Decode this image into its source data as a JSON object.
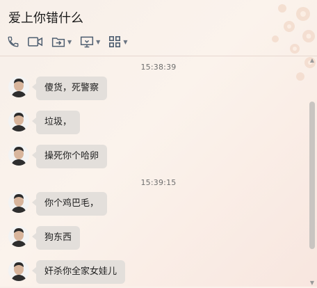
{
  "window": {
    "title": "爱上你错什么"
  },
  "toolbar": {
    "icons": [
      "phone-icon",
      "video-icon",
      "share-screen-icon",
      "remote-desktop-icon",
      "apps-grid-icon"
    ]
  },
  "chat": {
    "timestamps": [
      "15:38:39",
      "15:39:15"
    ],
    "messages": [
      {
        "text": "傻货，死警察"
      },
      {
        "text": "垃圾，"
      },
      {
        "text": "操死你个哈卵"
      },
      {
        "text": "你个鸡巴毛，"
      },
      {
        "text": "狗东西"
      },
      {
        "text": "奸杀你全家女娃儿"
      }
    ]
  }
}
